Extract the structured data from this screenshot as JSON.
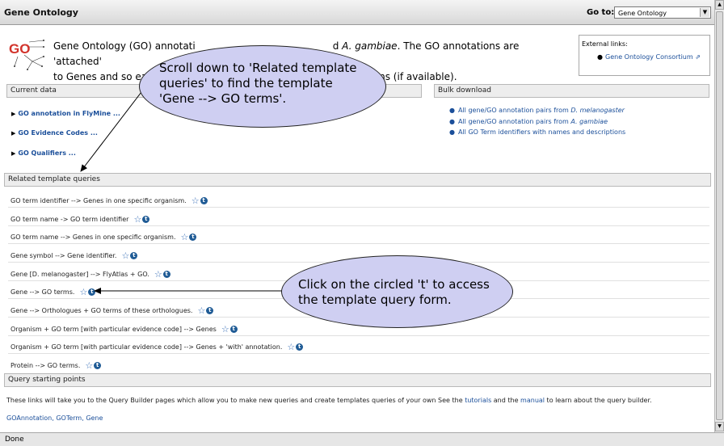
{
  "window": {
    "title": "Gene Ontology",
    "goto_label": "Go to:",
    "goto_value": "Gene Ontology"
  },
  "intro": {
    "line1_a": "Gene Ontology (GO) annotati",
    "line1_b": "d ",
    "line1_species": "A. gambiae",
    "line1_c": ". The GO annotations are 'attached'",
    "line2_a": "to Genes and so each",
    "line2_b": "otations (if available)."
  },
  "external_links": {
    "heading": "External links:",
    "link": "Gene Ontology Consortium"
  },
  "current_data": {
    "heading": "Current data",
    "items": [
      "GO annotation in FlyMine ...",
      "GO Evidence Codes ...",
      "GO Qualifiers ..."
    ]
  },
  "bulk_download": {
    "heading": "Bulk download",
    "items": [
      {
        "text": "All gene/GO annotation pairs from ",
        "species": "D. melanogaster"
      },
      {
        "text": "All gene/GO annotation pairs from ",
        "species": "A. gambiae"
      },
      {
        "text": "All GO Term identifiers with names and descriptions",
        "species": ""
      }
    ]
  },
  "related_templates": {
    "heading": "Related template queries",
    "items": [
      "GO term identifier --> Genes in one specific organism.",
      "GO term name -> GO term identifier",
      "GO term name --> Genes in one specific organism.",
      "Gene symbol --> Gene identifier.",
      "Gene [D. melanogaster] --> FlyAtlas + GO.",
      "Gene --> GO terms.",
      "Gene --> Orthologues + GO terms of these orthologues.",
      "Organism + GO term [with particular evidence code] --> Genes",
      "Organism + GO term [with particular evidence code] --> Genes + 'with' annotation.",
      "Protein --> GO terms."
    ],
    "info_glyph": "t"
  },
  "query_starting_points": {
    "heading": "Query starting points",
    "text_a": "These links will take you to the Query Builder pages which allow you to make new queries and create templates queries of your own See the ",
    "link_tutorials": "tutorials",
    "text_b": " and the ",
    "link_manual": "manual",
    "text_c": " to learn about the query builder.",
    "links": [
      "GOAnnotation",
      "GOTerm",
      "Gene"
    ]
  },
  "callouts": {
    "scroll": [
      "Scroll down to 'Related template",
      "queries' to find the template",
      "'Gene --> GO terms'."
    ],
    "click": [
      "Click on the circled 't' to access",
      "the template query form."
    ]
  },
  "status": "Done",
  "colors": {
    "link": "#1b4f9a",
    "callout_fill": "#cfcff2",
    "info_badge": "#1f5b95"
  }
}
